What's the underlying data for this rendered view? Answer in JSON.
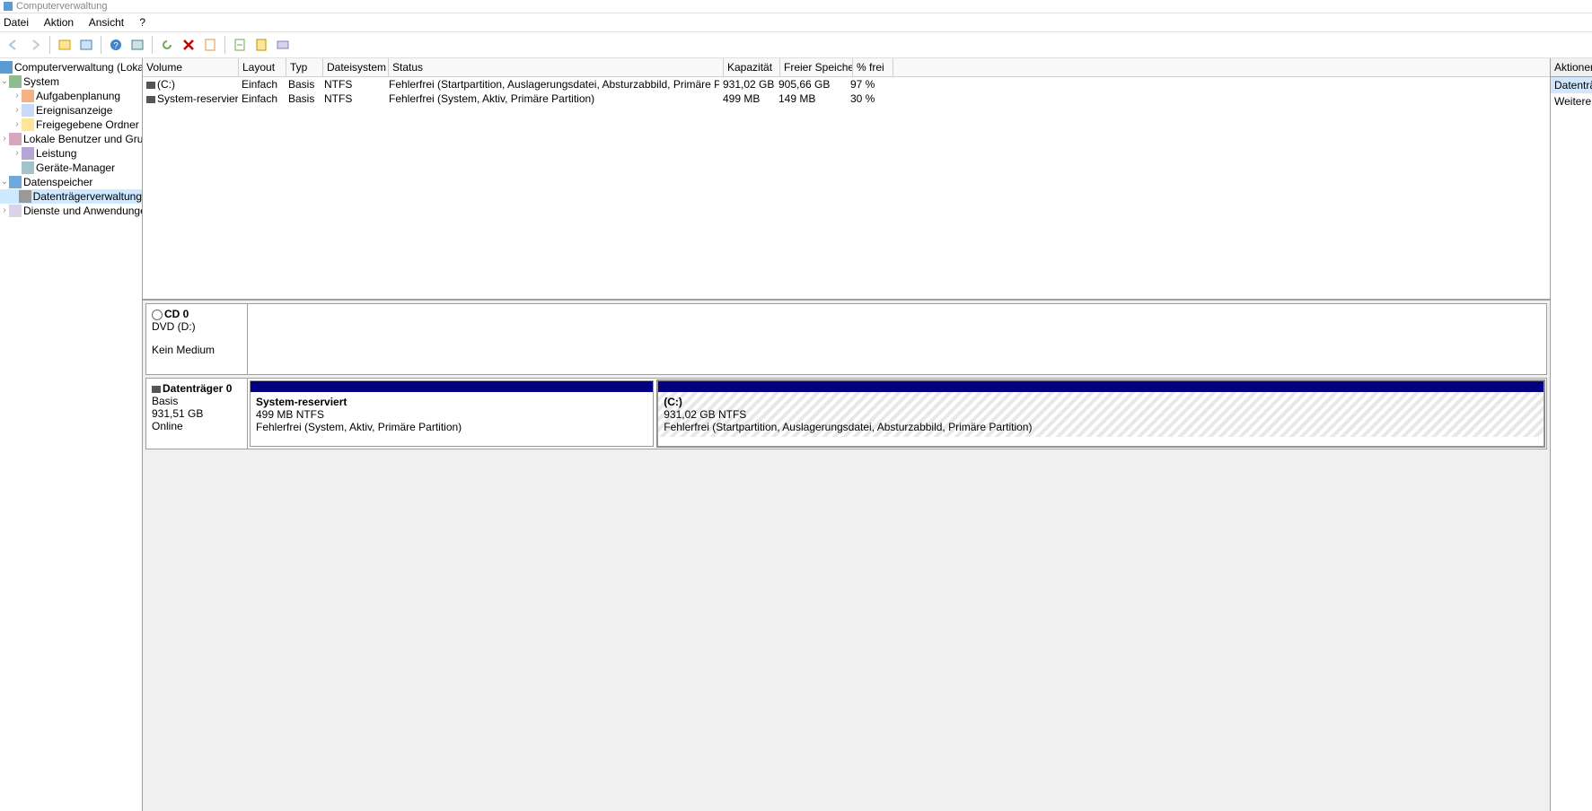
{
  "window_title": "Computerverwaltung",
  "menu": {
    "file": "Datei",
    "action": "Aktion",
    "view": "Ansicht",
    "help": "?"
  },
  "tree": {
    "root": "Computerverwaltung (Lokal)",
    "system": {
      "label": "System",
      "task": "Aufgabenplanung",
      "event": "Ereignisanzeige",
      "shared": "Freigegebene Ordner",
      "users": "Lokale Benutzer und Gruppen",
      "perf": "Leistung",
      "dev": "Geräte-Manager"
    },
    "storage": {
      "label": "Datenspeicher",
      "diskmgmt": "Datenträgerverwaltung"
    },
    "services": "Dienste und Anwendungen"
  },
  "columns": {
    "volume": "Volume",
    "layout": "Layout",
    "typ": "Typ",
    "fs": "Dateisystem",
    "status": "Status",
    "cap": "Kapazität",
    "free": "Freier Speicher",
    "pct": "% frei"
  },
  "volumes": [
    {
      "name": "(C:)",
      "layout": "Einfach",
      "typ": "Basis",
      "fs": "NTFS",
      "status": "Fehlerfrei (Startpartition, Auslagerungsdatei, Absturzabbild, Primäre Partition)",
      "cap": "931,02 GB",
      "free": "905,66 GB",
      "pct": "97 %"
    },
    {
      "name": "System-reserviert",
      "layout": "Einfach",
      "typ": "Basis",
      "fs": "NTFS",
      "status": "Fehlerfrei (System, Aktiv, Primäre Partition)",
      "cap": "499 MB",
      "free": "149 MB",
      "pct": "30 %"
    }
  ],
  "cd": {
    "title": "CD 0",
    "line2": "DVD (D:)",
    "line3": "Kein Medium"
  },
  "disk0": {
    "title": "Datenträger 0",
    "type": "Basis",
    "size": "931,51 GB",
    "state": "Online",
    "p1": {
      "name": "System-reserviert",
      "info": "499 MB NTFS",
      "status": "Fehlerfrei (System, Aktiv, Primäre Partition)"
    },
    "p2": {
      "name": "(C:)",
      "info": "931,02 GB NTFS",
      "status": "Fehlerfrei (Startpartition, Auslagerungsdatei, Absturzabbild, Primäre Partition)"
    }
  },
  "actions": {
    "header": "Aktionen",
    "item1": "Datenträgerverwaltung",
    "item2": "Weitere Aktionen"
  }
}
